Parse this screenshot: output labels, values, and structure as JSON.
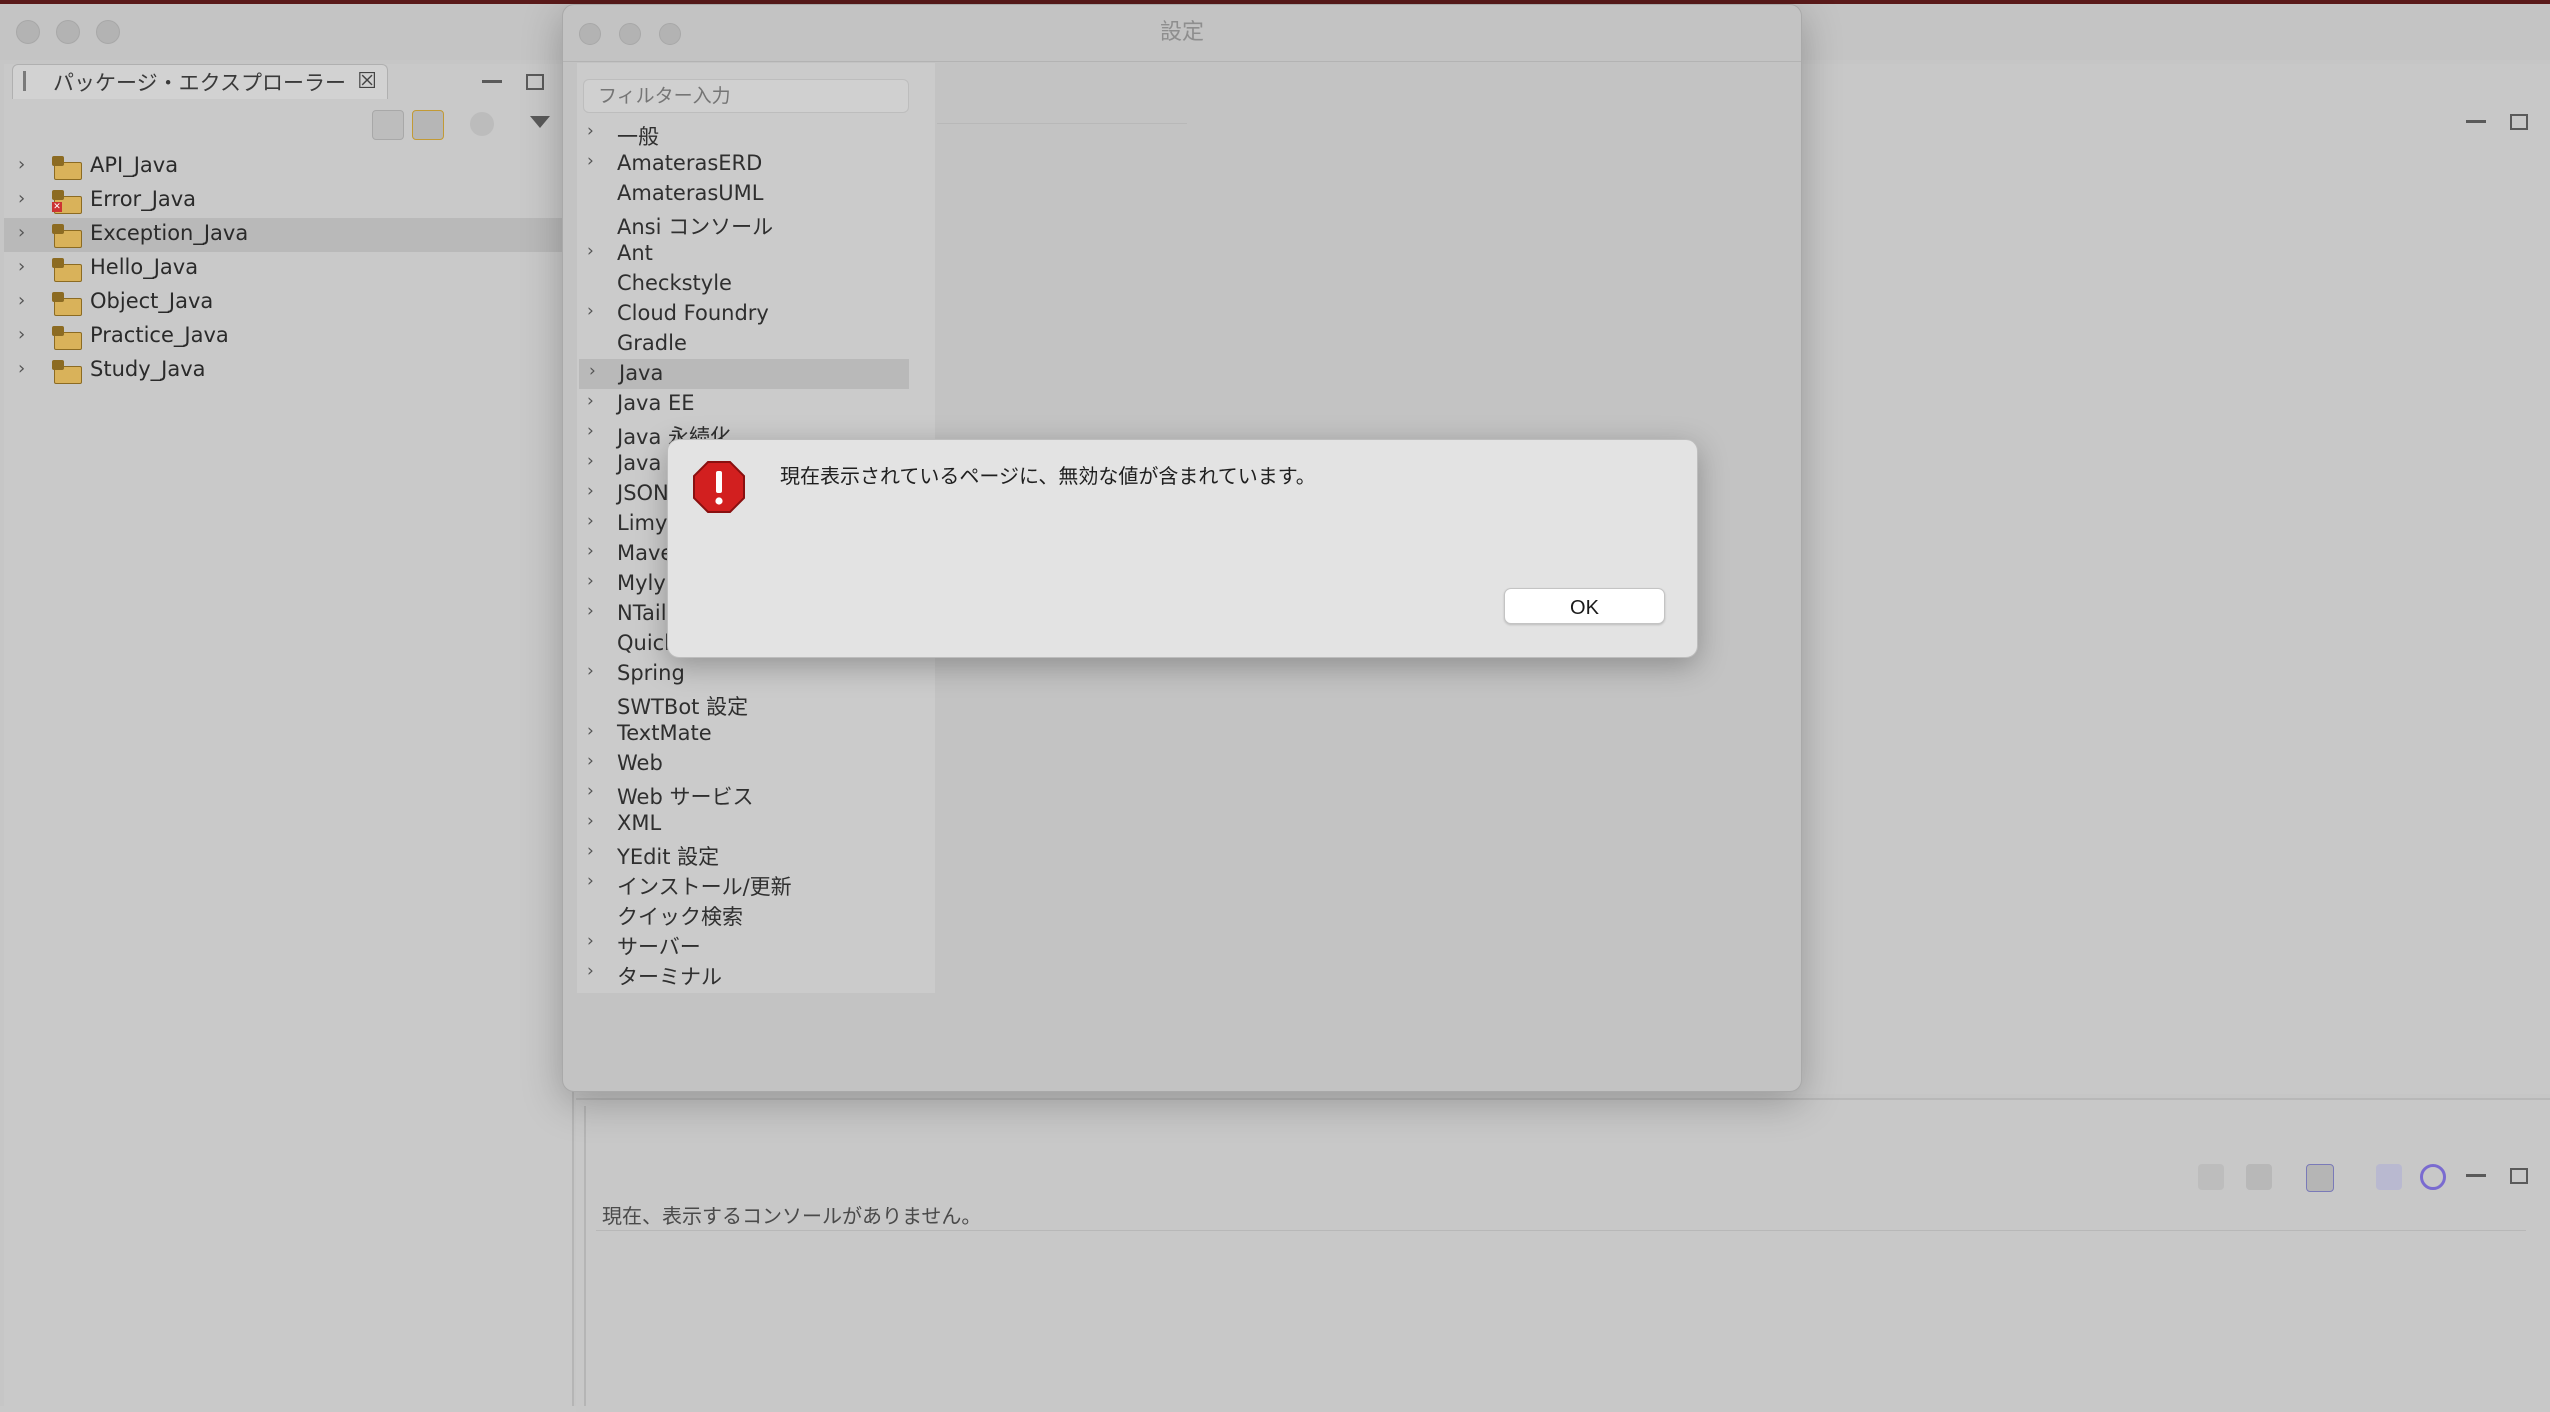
{
  "explorer": {
    "tab_label": "パッケージ・エクスプローラー",
    "projects": [
      {
        "name": "API_Java",
        "error": false,
        "selected": false
      },
      {
        "name": "Error_Java",
        "error": true,
        "selected": false
      },
      {
        "name": "Exception_Java",
        "error": false,
        "selected": true
      },
      {
        "name": "Hello_Java",
        "error": false,
        "selected": false
      },
      {
        "name": "Object_Java",
        "error": false,
        "selected": false
      },
      {
        "name": "Practice_Java",
        "error": false,
        "selected": false
      },
      {
        "name": "Study_Java",
        "error": false,
        "selected": false
      }
    ]
  },
  "preferences": {
    "title": "設定",
    "filter_placeholder": "フィルター入力",
    "items": [
      {
        "label": "一般",
        "expandable": true
      },
      {
        "label": "AmaterasERD",
        "expandable": true
      },
      {
        "label": "AmaterasUML",
        "expandable": false
      },
      {
        "label": "Ansi コンソール",
        "expandable": false
      },
      {
        "label": "Ant",
        "expandable": true
      },
      {
        "label": "Checkstyle",
        "expandable": false
      },
      {
        "label": "Cloud Foundry",
        "expandable": true
      },
      {
        "label": "Gradle",
        "expandable": false
      },
      {
        "label": "Java",
        "expandable": true,
        "selected": true
      },
      {
        "label": "Java EE",
        "expandable": true
      },
      {
        "label": "Java 永続化",
        "expandable": true
      },
      {
        "label": "Java",
        "expandable": true
      },
      {
        "label": "JSON",
        "expandable": true
      },
      {
        "label": "Limy",
        "expandable": true
      },
      {
        "label": "Maven",
        "expandable": true
      },
      {
        "label": "Mylyn",
        "expandable": true
      },
      {
        "label": "NTail",
        "expandable": true
      },
      {
        "label": "Quick",
        "expandable": false
      },
      {
        "label": "Spring",
        "expandable": true
      },
      {
        "label": "SWTBot 設定",
        "expandable": false
      },
      {
        "label": "TextMate",
        "expandable": true
      },
      {
        "label": "Web",
        "expandable": true
      },
      {
        "label": "Web サービス",
        "expandable": true
      },
      {
        "label": "XML",
        "expandable": true
      },
      {
        "label": "YEdit 設定",
        "expandable": true
      },
      {
        "label": "インストール/更新",
        "expandable": true
      },
      {
        "label": "クイック検索",
        "expandable": false
      },
      {
        "label": "サーバー",
        "expandable": true
      },
      {
        "label": "ターミナル",
        "expandable": true
      }
    ]
  },
  "alert": {
    "message": "現在表示されているページに、無効な値が含まれています。",
    "ok_label": "OK"
  },
  "console": {
    "empty_message": "現在、表示するコンソールがありません。"
  },
  "colors": {
    "selection": "#b9b9b9",
    "alert_icon": "#d21f1f",
    "folder": "#d9b25a"
  }
}
